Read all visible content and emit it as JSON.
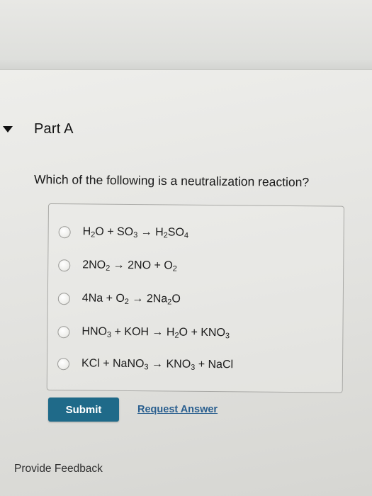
{
  "part": {
    "title": "Part A"
  },
  "question": {
    "text": "Which of the following is a neutralization reaction?"
  },
  "choices": [
    {
      "pre": "H",
      "s1": "2",
      "mid": "O + SO",
      "s2": "3",
      "post": " → H",
      "s3": "2",
      "tail": "SO",
      "s4": "4",
      "end": "",
      "selected": false
    },
    {
      "pre": "2NO",
      "s1": "2",
      "mid": " → 2NO + O",
      "s2": "2",
      "post": "",
      "s3": "",
      "tail": "",
      "s4": "",
      "end": "",
      "selected": false
    },
    {
      "pre": "4Na + O",
      "s1": "2",
      "mid": " → 2Na",
      "s2": "2",
      "post": "O",
      "s3": "",
      "tail": "",
      "s4": "",
      "end": "",
      "selected": false
    },
    {
      "pre": "HNO",
      "s1": "3",
      "mid": " + KOH → H",
      "s2": "2",
      "post": "O + KNO",
      "s3": "3",
      "tail": "",
      "s4": "",
      "end": "",
      "selected": false
    },
    {
      "pre": "KCl + NaNO",
      "s1": "3",
      "mid": " → KNO",
      "s2": "3",
      "post": " + NaCl",
      "s3": "",
      "tail": "",
      "s4": "",
      "end": "",
      "selected": false
    }
  ],
  "actions": {
    "submit_label": "Submit",
    "request_answer_label": "Request Answer"
  },
  "footer": {
    "feedback_label": "Provide Feedback"
  },
  "colors": {
    "submit_bg": "#1f6a89",
    "link": "#2a5f8f"
  }
}
